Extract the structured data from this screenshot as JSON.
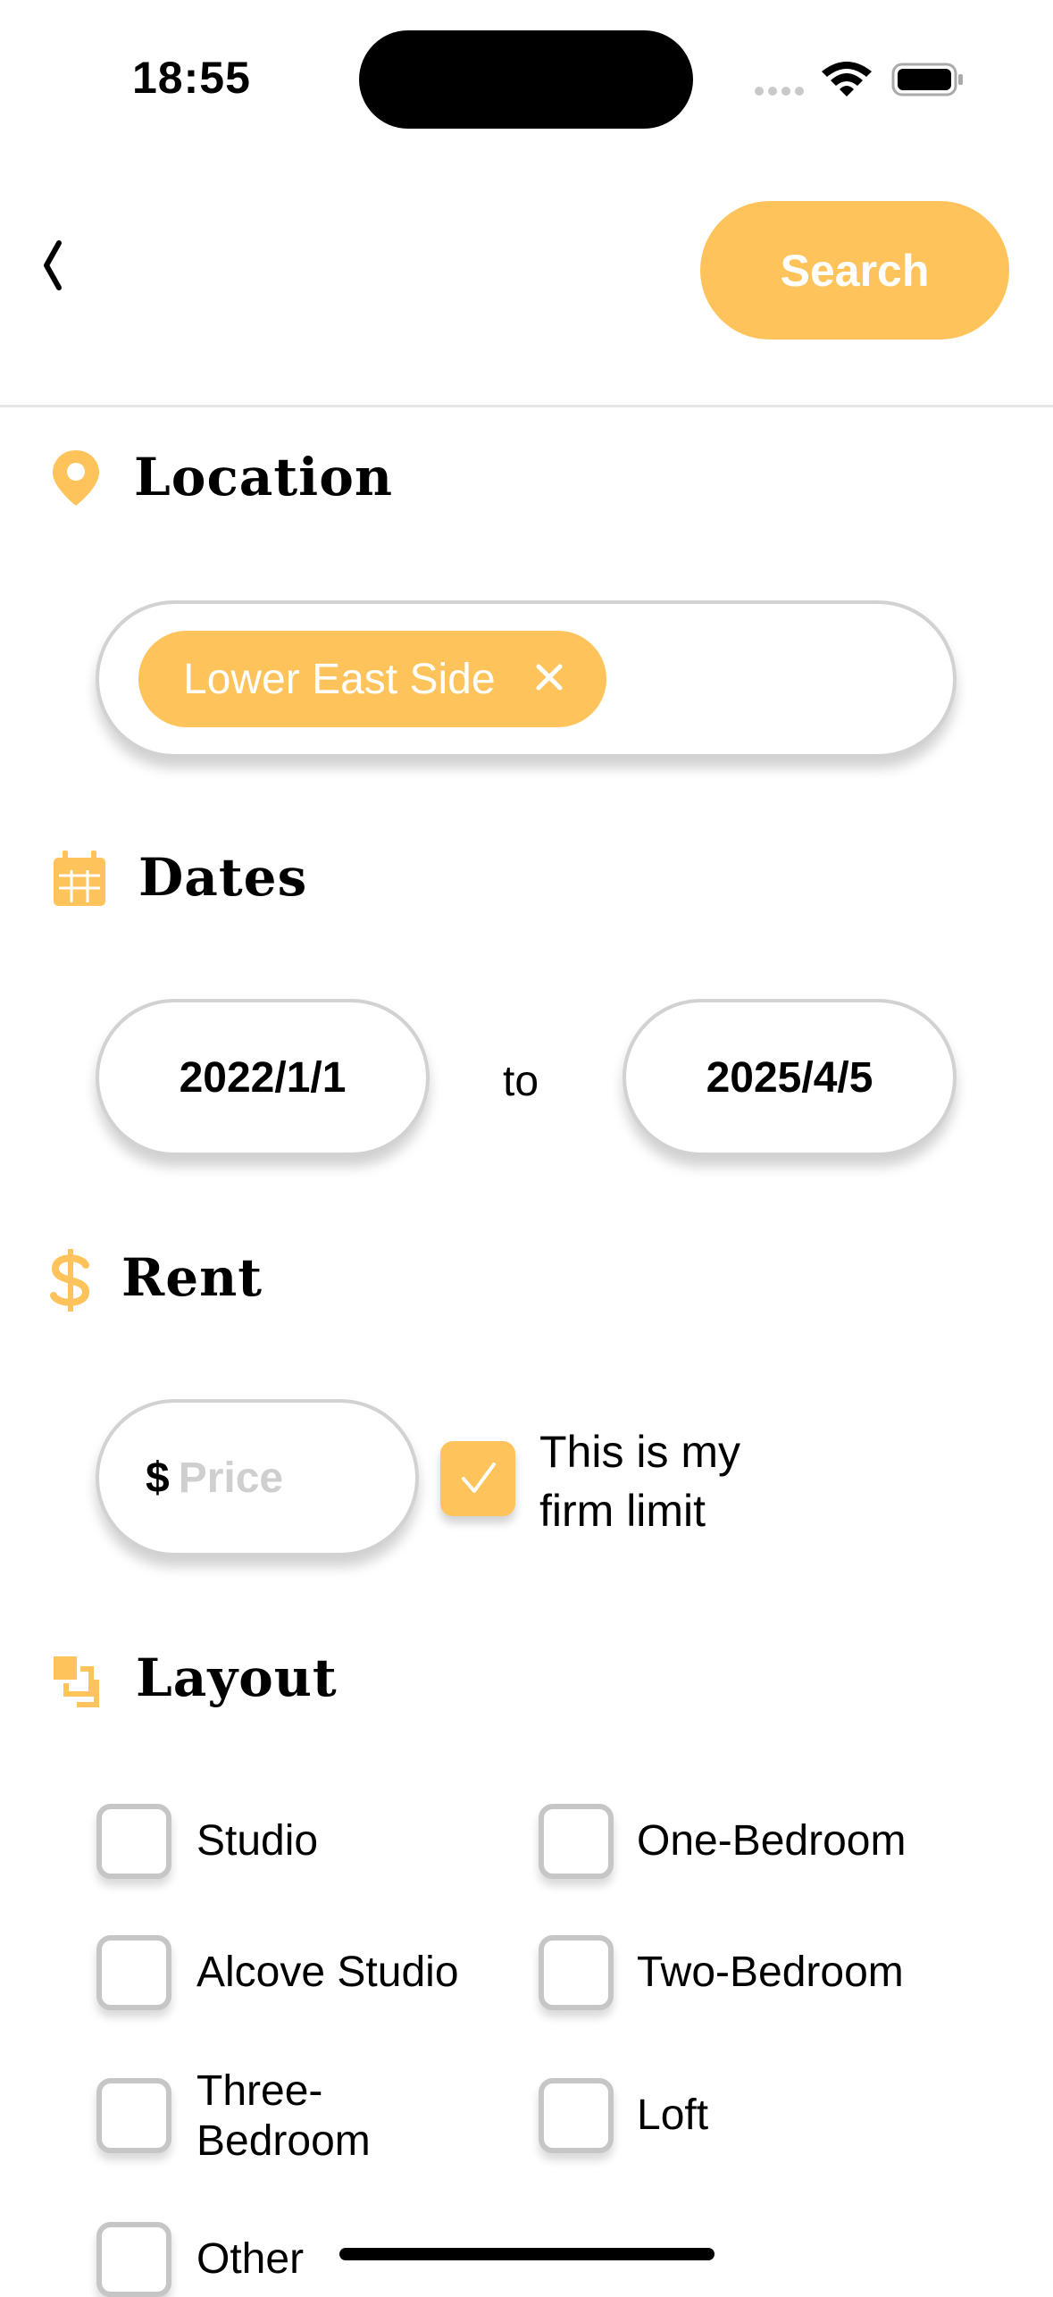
{
  "status_bar": {
    "time": "18:55"
  },
  "nav": {
    "back_icon": "chevron-left-icon",
    "search_label": "Search"
  },
  "sections": {
    "location": {
      "title": "Location",
      "icon": "map-pin-icon",
      "chip_label": "Lower East Side"
    },
    "dates": {
      "title": "Dates",
      "icon": "calendar-icon",
      "start": "2022/1/1",
      "separator": "to",
      "end": "2025/4/5"
    },
    "rent": {
      "title": "Rent",
      "icon": "dollar-icon",
      "currency_symbol": "$",
      "price_placeholder": "Price",
      "firm_limit_label": "This is my firm limit",
      "firm_limit_checked": true
    },
    "layout": {
      "title": "Layout",
      "icon": "layers-icon",
      "options": [
        {
          "label": "Studio",
          "checked": false
        },
        {
          "label": "One-Bedroom",
          "checked": false
        },
        {
          "label": "Alcove Studio",
          "checked": false
        },
        {
          "label": "Two-Bedroom",
          "checked": false
        },
        {
          "label": "Three-Bedroom",
          "checked": false
        },
        {
          "label": "Loft",
          "checked": false
        },
        {
          "label": "Other",
          "checked": false
        }
      ]
    }
  },
  "colors": {
    "accent": "#ffc35c",
    "border": "#d2d2d2"
  }
}
